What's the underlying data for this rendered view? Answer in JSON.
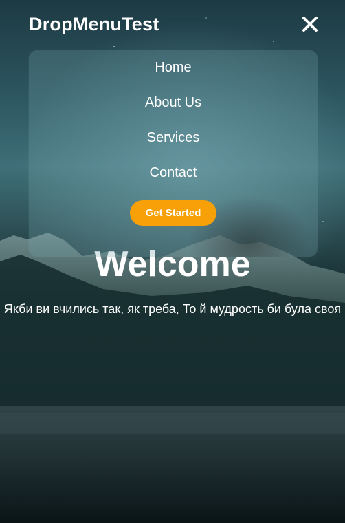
{
  "header": {
    "brand": "DropMenuTest",
    "close_icon": "close-icon"
  },
  "menu": {
    "items": [
      {
        "label": "Home"
      },
      {
        "label": "About Us"
      },
      {
        "label": "Services"
      },
      {
        "label": "Contact"
      }
    ],
    "cta_label": "Get Started"
  },
  "hero": {
    "title": "Welcome",
    "subtitle": "Якби ви вчились так, як треба, То й мудрость би була своя"
  },
  "colors": {
    "accent": "#f7a008",
    "text": "#ffffff"
  }
}
